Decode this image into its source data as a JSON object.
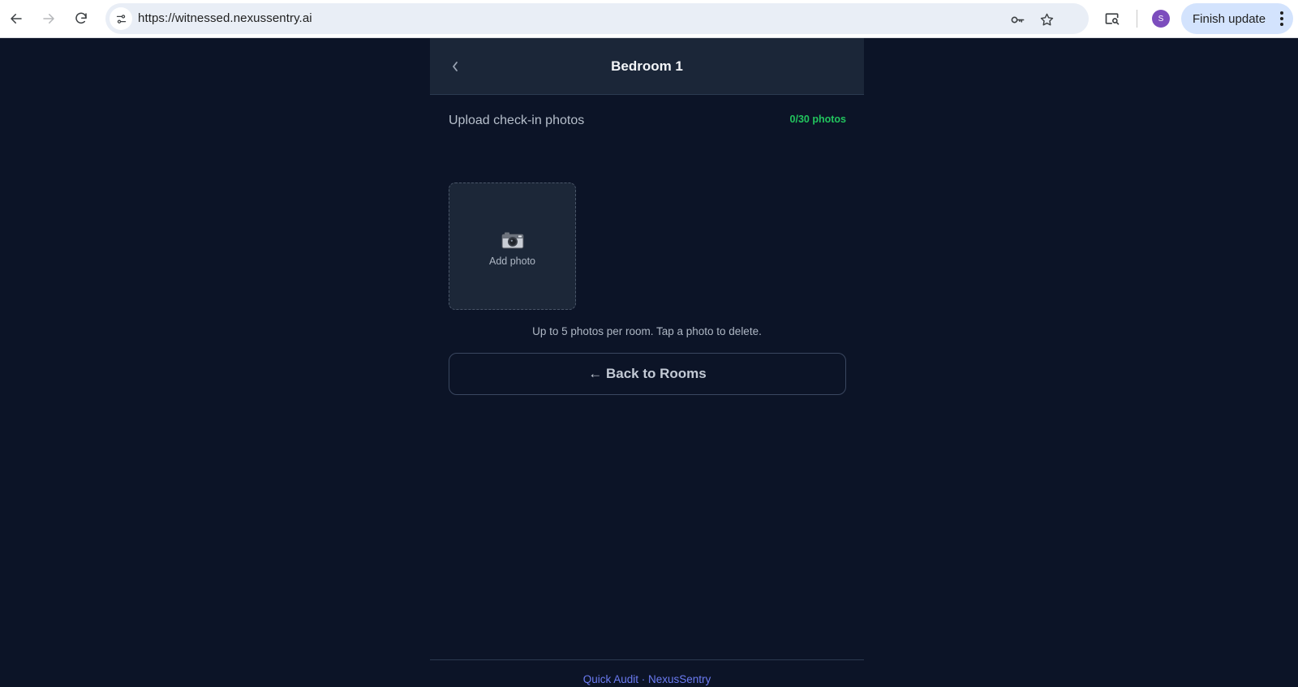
{
  "browser": {
    "url": "https://witnessed.nexussentry.ai",
    "profile_initial": "S",
    "update_label": "Finish update"
  },
  "header": {
    "title": "Bedroom 1"
  },
  "upload": {
    "label": "Upload check-in photos",
    "count": "0/30 photos",
    "add_label": "Add photo",
    "hint": "Up to 5 photos per room. Tap a photo to delete."
  },
  "back_rooms_label": "← Back to Rooms",
  "footer": {
    "left": "Quick Audit",
    "separator": "·",
    "right": "NexusSentry"
  },
  "colors": {
    "page_bg": "#0c1427",
    "header_bg": "#1b2638",
    "count_green": "#22c55e",
    "footer_link": "#6b7bf2"
  }
}
